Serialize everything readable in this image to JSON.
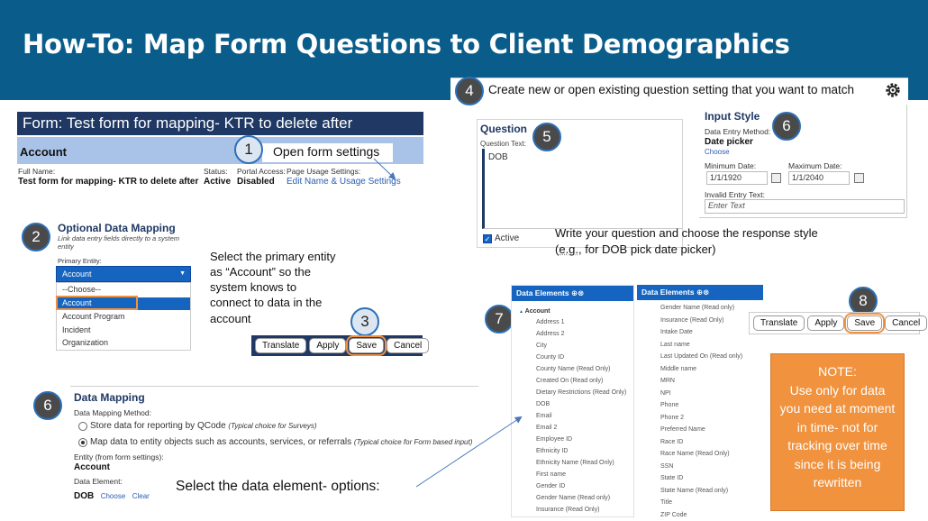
{
  "title": "How-To: Map Form Questions to Client Demographics",
  "steps": {
    "s1": "1",
    "s2": "2",
    "s3": "3",
    "s4": "4",
    "s5": "5",
    "s6a": "6",
    "s6b": "6",
    "s7": "7",
    "s8": "8"
  },
  "step4_text": "Create new or open existing question setting that you want to match",
  "form": {
    "title": "Form: Test form for mapping- KTR to delete after",
    "account_header": "Account",
    "open_settings": "Open form settings",
    "full_name_label": "Full Name:",
    "full_name_value": "Test form for mapping- KTR to delete after",
    "status_label": "Status:",
    "status_value": "Active",
    "portal_label": "Portal Access:",
    "portal_value": "Disabled",
    "usage_label": "Page Usage Settings:",
    "usage_link": "Edit Name & Usage Settings"
  },
  "optional_mapping": {
    "title": "Optional Data Mapping",
    "desc": "Link data entry fields directly to a system entity",
    "primary_label": "Primary Entity:",
    "selected": "Account",
    "options": [
      "--Choose--",
      "Account",
      "Account Program",
      "Incident",
      "Organization"
    ]
  },
  "step2_note": "Select the primary entity as “Account” so the system knows to connect to data in the account",
  "buttons": {
    "translate": "Translate",
    "apply": "Apply",
    "save": "Save",
    "cancel": "Cancel"
  },
  "data_mapping": {
    "title": "Data Mapping",
    "method_label": "Data Mapping Method:",
    "opt1": "Store data for reporting by QCode",
    "opt1_hint": "(Typical choice for Surveys)",
    "opt2": "Map data to entity objects such as accounts, services, or referrals",
    "opt2_hint": "(Typical choice for Form based input)",
    "entity_label": "Entity (from form settings):",
    "entity_value": "Account",
    "element_label": "Data Element:",
    "element_value": "DOB",
    "choose": "Choose",
    "clear": "Clear"
  },
  "step6b_note": "Select the data element- options:",
  "question": {
    "title": "Question",
    "text_label": "Question Text:",
    "text_value": "DOB",
    "active": "Active"
  },
  "input_style": {
    "title": "Input Style",
    "method_label": "Data Entry Method:",
    "method_value": "Date picker",
    "choose": "Choose",
    "min_label": "Minimum Date:",
    "min_value": "1/1/1920",
    "max_label": "Maximum Date:",
    "max_value": "1/1/2040",
    "invalid_label": "Invalid Entry Text:",
    "invalid_placeholder": "Enter Text"
  },
  "step5_note_line1": "Write your question and choose the response style",
  "step5_note_line2_pre": "(",
  "step5_note_line2_eg": "e.g.",
  "step5_note_line2_post": ", for DOB pick date picker)",
  "data_elements": {
    "header": "Data Elements",
    "col1_root": "Account",
    "col1": [
      "Address 1",
      "Address 2",
      "City",
      "County ID",
      "County Name (Read Only)",
      "Created On (Read only)",
      "Dietary Restrictions (Read Only)",
      "DOB",
      "Email",
      "Email 2",
      "Employee ID",
      "Ethnicity ID",
      "Ethnicity Name (Read Only)",
      "First name",
      "Gender ID",
      "Gender Name (Read only)",
      "Insurance (Read Only)"
    ],
    "col2": [
      "Gender Name (Read only)",
      "Insurance (Read Only)",
      "Intake Date",
      "Last name",
      "Last Updated On (Read only)",
      "Middle name",
      "MRN",
      "NPI",
      "Phone",
      "Phone 2",
      "Preferred Name",
      "Race ID",
      "Race Name (Read Only)",
      "SSN",
      "State ID",
      "State Name (Read only)",
      "Title",
      "ZIP Code"
    ]
  },
  "note": {
    "heading": "NOTE:",
    "body": "Use only for data you need at moment in time- not for tracking over time since it is being rewritten"
  },
  "colors": {
    "title_bar": "#0a5d8a",
    "navy": "#1f3864",
    "accent_blue": "#1565c0",
    "highlight_orange": "#f0923e"
  }
}
